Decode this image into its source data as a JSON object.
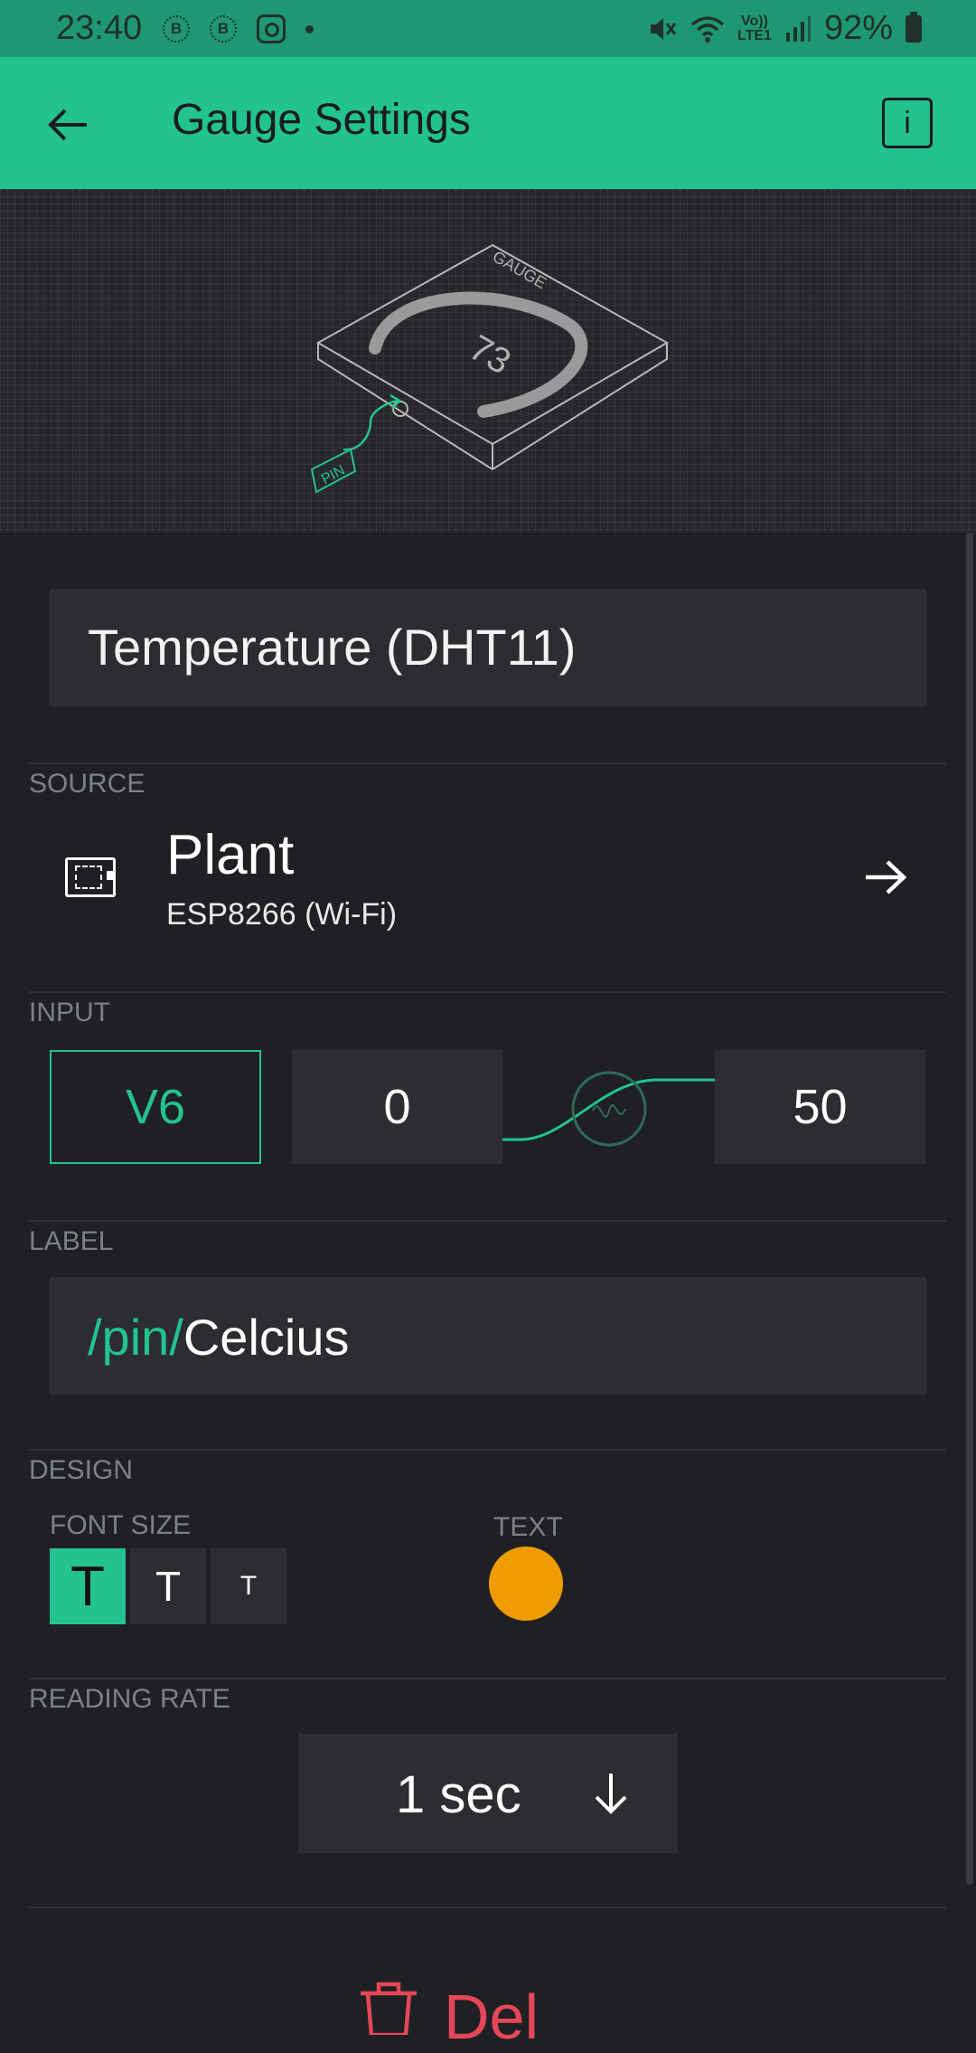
{
  "status_bar": {
    "time": "23:40",
    "left_icons": [
      "b-circle-icon",
      "b-circle-icon",
      "instagram-icon",
      "dot-icon"
    ],
    "network_label_top": "Vo))",
    "network_label_bottom": "LTE1",
    "battery": "92%"
  },
  "app_bar": {
    "title": "Gauge Settings",
    "info_label": "i"
  },
  "preview": {
    "gauge_label": "GAUGE",
    "gauge_value": "73",
    "pin_label": "PIN"
  },
  "widget_name": "Temperature (DHT11)",
  "source": {
    "section": "SOURCE",
    "device_name": "Plant",
    "device_model": "ESP8266 (Wi-Fi)"
  },
  "input": {
    "section": "INPUT",
    "pin": "V6",
    "min": "0",
    "max": "50"
  },
  "label": {
    "section": "LABEL",
    "prefix": "/pin/",
    "value": "Celcius"
  },
  "design": {
    "section": "DESIGN",
    "font_size_label": "FONT SIZE",
    "font_sizes": [
      "T",
      "T",
      "T"
    ],
    "selected_font_size": 0,
    "text_label": "TEXT",
    "text_color": "#ef9c00"
  },
  "reading_rate": {
    "section": "READING RATE",
    "value": "1 sec"
  },
  "delete": {
    "label": "Del"
  },
  "colors": {
    "accent": "#22c38e",
    "background": "#1f2023",
    "danger": "#e54757"
  }
}
